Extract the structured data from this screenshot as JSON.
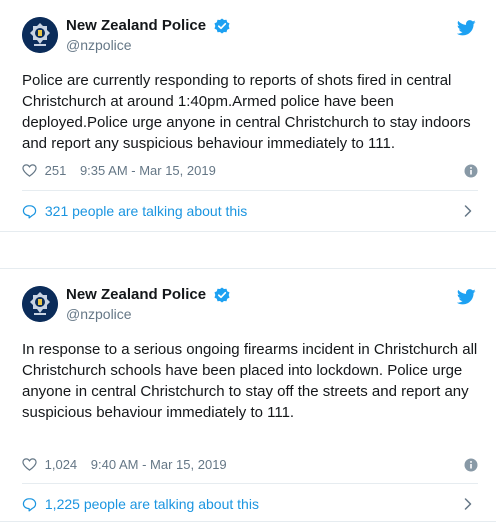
{
  "colors": {
    "brand_blue": "#1da1f2",
    "link_blue": "#1b95e0",
    "text": "#14171a",
    "muted": "#657786",
    "border": "#e6ecf0"
  },
  "icons": {
    "avatar": "police-badge-avatar",
    "verified": "verified-badge-icon",
    "twitter": "twitter-bird-icon",
    "like": "heart-icon",
    "info": "info-icon",
    "comments": "speech-bubble-icon",
    "chevron": "chevron-right-icon"
  },
  "tweets": [
    {
      "display_name": "New Zealand Police",
      "handle": "@nzpolice",
      "text": "Police are currently responding to reports of shots fired in central Christchurch at around 1:40pm.Armed police have been deployed.Police urge anyone in central Christchurch to stay indoors and report any suspicious behaviour immediately to 111.",
      "likes": "251",
      "timestamp": "9:35 AM - Mar 15, 2019",
      "talking": "321 people are talking about this"
    },
    {
      "display_name": "New Zealand Police",
      "handle": "@nzpolice",
      "text": "In response to a serious ongoing firearms incident in Christchurch all Christchurch schools have been placed into lockdown. Police urge anyone in central Christchurch to stay off the streets and report any suspicious behaviour immediately to 111.",
      "likes": "1,024",
      "timestamp": "9:40 AM - Mar 15, 2019",
      "talking": "1,225 people are talking about this"
    }
  ]
}
